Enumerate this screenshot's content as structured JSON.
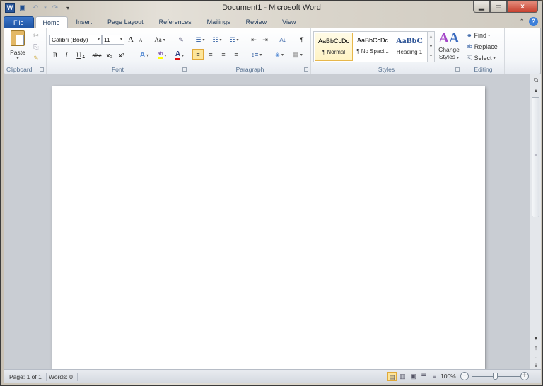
{
  "window": {
    "title": "Document1 - Microsoft Word",
    "minimize": "–",
    "maximize": "▫",
    "close": "x"
  },
  "qat": {
    "app_icon": "W",
    "save": "💾",
    "undo": "↶",
    "undo_dd": "▾",
    "redo": "↷",
    "customize": "▾"
  },
  "tabs": [
    {
      "label": "File"
    },
    {
      "label": "Home"
    },
    {
      "label": "Insert"
    },
    {
      "label": "Page Layout"
    },
    {
      "label": "References"
    },
    {
      "label": "Mailings"
    },
    {
      "label": "Review"
    },
    {
      "label": "View"
    }
  ],
  "ribbon_right": {
    "minimize": "⌃",
    "help": "?"
  },
  "clipboard": {
    "label": "Clipboard",
    "paste": "Paste",
    "cut": "✂",
    "copy": "⎘",
    "format_painter": "🖌"
  },
  "font": {
    "label": "Font",
    "font_name": "Calibri (Body)",
    "font_size": "11",
    "grow": "A",
    "shrink": "A",
    "change_case": "Aa",
    "clear": "✎",
    "bold": "B",
    "italic": "I",
    "underline": "U",
    "strike": "abc",
    "subscript": "x₂",
    "superscript": "x²",
    "text_effects": "A",
    "highlight": "ab",
    "font_color": "A",
    "highlight_color": "#ffff00",
    "font_color_bar": "#e01010"
  },
  "paragraph": {
    "label": "Paragraph",
    "bullets": "☰",
    "numbering": "☷",
    "multilevel": "☶",
    "decrease_indent": "⇤",
    "increase_indent": "⇥",
    "sort": "A↓",
    "pilcrow": "¶",
    "align_left": "≡",
    "center": "≡",
    "align_right": "≡",
    "justify": "≡",
    "line_spacing": "↕≡",
    "shading": "◈",
    "borders": "▦"
  },
  "styles": {
    "label": "Styles",
    "items": [
      {
        "sample": "AaBbCcDc",
        "name": "¶ Normal"
      },
      {
        "sample": "AaBbCcDc",
        "name": "¶ No Spaci..."
      },
      {
        "sample": "AaBbC",
        "name": "Heading 1"
      }
    ],
    "change_styles": "Change",
    "change_styles2": "Styles"
  },
  "editing": {
    "label": "Editing",
    "find": "Find",
    "replace": "Replace",
    "select": "Select"
  },
  "status": {
    "page": "Page: 1 of 1",
    "words": "Words: 0",
    "zoom": "100%",
    "zoom_level_percent": 100
  },
  "accent": {
    "file_tab": "#2b5fb0",
    "selection": "#fde59a"
  }
}
